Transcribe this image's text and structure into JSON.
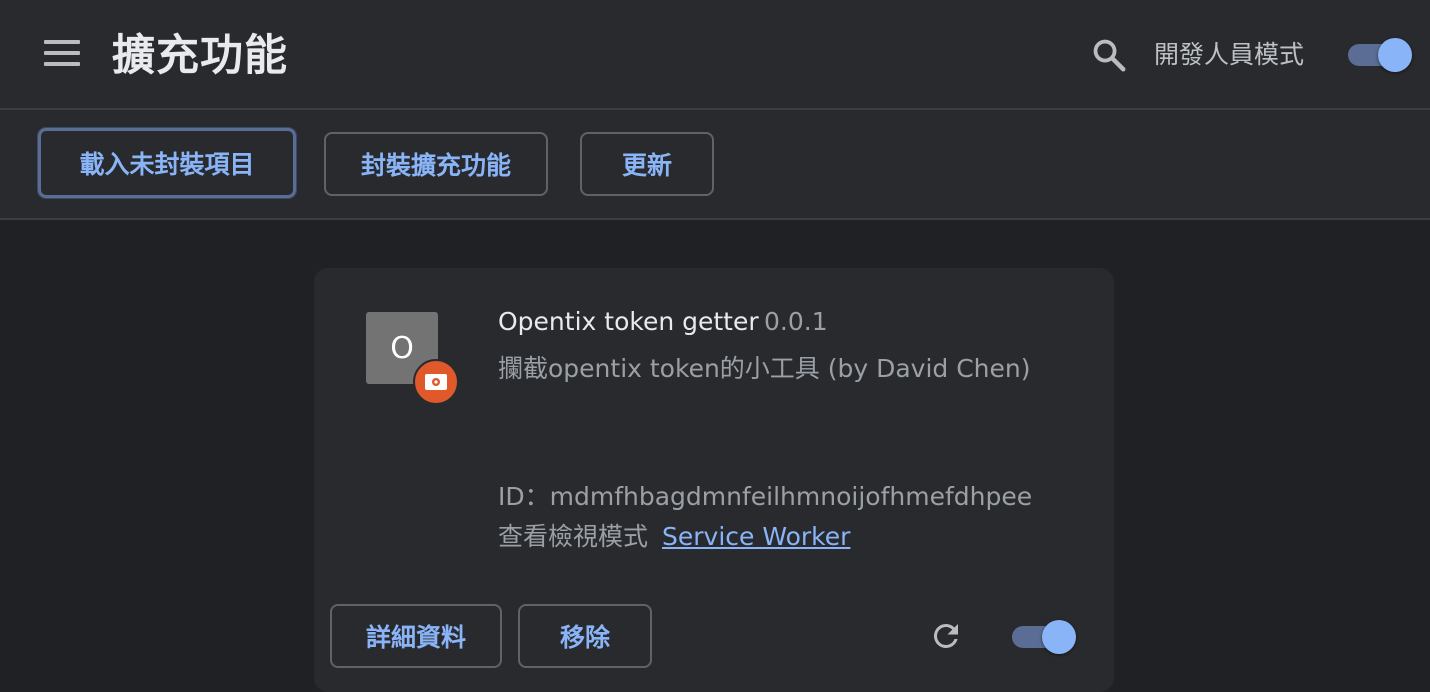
{
  "header": {
    "title": "擴充功能",
    "developer_mode_label": "開發人員模式",
    "developer_mode_on": true
  },
  "toolbar": {
    "load_unpacked_label": "載入未封裝項目",
    "pack_extension_label": "封裝擴充功能",
    "update_label": "更新"
  },
  "extension": {
    "icon_letter": "O",
    "name": "Opentix token getter",
    "version": "0.0.1",
    "description": "攔截opentix token的小工具 (by David Chen)",
    "id_text": "ID：mdmfhbagdmnfeilhmnoijofhmefdhpee",
    "inspect_views_label": "查看檢視模式",
    "service_worker_link": "Service Worker",
    "details_label": "詳細資料",
    "remove_label": "移除",
    "enabled": true
  },
  "colors": {
    "accent": "#8ab4f8",
    "background": "#202124",
    "surface": "#292a2d",
    "badge": "#e0592b"
  },
  "icons": [
    "menu-icon",
    "search-icon",
    "unpacked-badge-icon",
    "reload-icon"
  ]
}
